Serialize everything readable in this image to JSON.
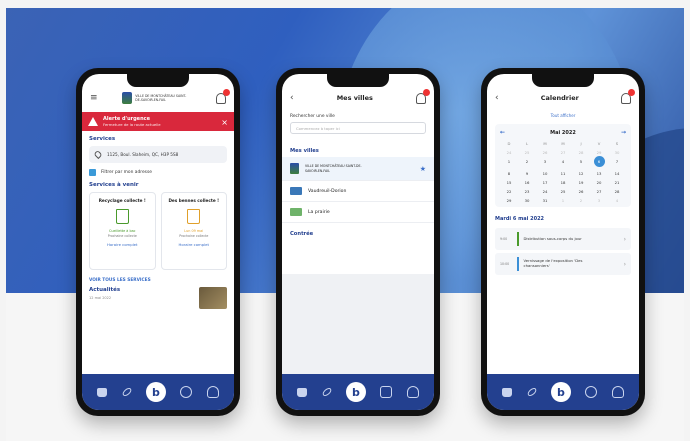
{
  "phone1": {
    "logo_text": "VILLE DE MONTCHÂTEAU SAINT-DE-SAVOIR-EN-FAIL",
    "alert": {
      "title": "Alerte d'urgence",
      "subtitle": "Fermeture de la route actuelle"
    },
    "services_title": "Services",
    "address": "1125, Boul. Slaheim, QC, H3P 5S8",
    "filter_label": "Filtrer par mon adresse",
    "upcoming_title": "Services à venir",
    "cards": [
      {
        "title": "Recyclage collecte !",
        "line1": "Cueillette à bac",
        "line2": "Prochaine collecte",
        "link": "Horaire complet"
      },
      {
        "title": "Des bennes collecte !",
        "line1": "Lun 09 mai",
        "line2": "Prochaine collecte",
        "link": "Horaire complet"
      }
    ],
    "see_all": "VOIR TOUS LES SERVICES",
    "news_title": "Actualités",
    "news_date": "12 mai 2022"
  },
  "phone2": {
    "title": "Mes villes",
    "search_label": "Rechercher une ville",
    "search_placeholder": "Commencez à taper ici",
    "list_title": "Mes villes",
    "cities": [
      {
        "name": "VILLE DE MONTCHÂTEAU SAINT-DE-SAVOIR-EN-FAIL"
      },
      {
        "name": "Vaudreuil-Dorion"
      },
      {
        "name": "La prairie"
      }
    ],
    "more_title": "Contrée"
  },
  "phone3": {
    "title": "Calendrier",
    "link": "Tout afficher",
    "month": "Mai 2022",
    "weekdays": [
      "D",
      "L",
      "M",
      "M",
      "J",
      "V",
      "S"
    ],
    "weeks": [
      [
        "24",
        "25",
        "26",
        "27",
        "28",
        "29",
        "30"
      ],
      [
        "1",
        "2",
        "3",
        "4",
        "5",
        "6",
        "7"
      ],
      [
        "8",
        "9",
        "10",
        "11",
        "12",
        "13",
        "14"
      ],
      [
        "15",
        "16",
        "17",
        "18",
        "19",
        "20",
        "21"
      ],
      [
        "22",
        "23",
        "24",
        "25",
        "26",
        "27",
        "28"
      ],
      [
        "29",
        "30",
        "31",
        "1",
        "2",
        "3",
        "4"
      ]
    ],
    "day_title": "Mardi 6 mai 2022",
    "events": [
      {
        "time": "9:00",
        "text": "Distribution sous-corps du jour"
      },
      {
        "time": "10:00",
        "text": "Vernissage de l'exposition 'Des chansonniers'"
      }
    ]
  },
  "colors": {
    "brand": "#23408f",
    "accent": "#3b8fd6",
    "alert": "#d9283c"
  }
}
